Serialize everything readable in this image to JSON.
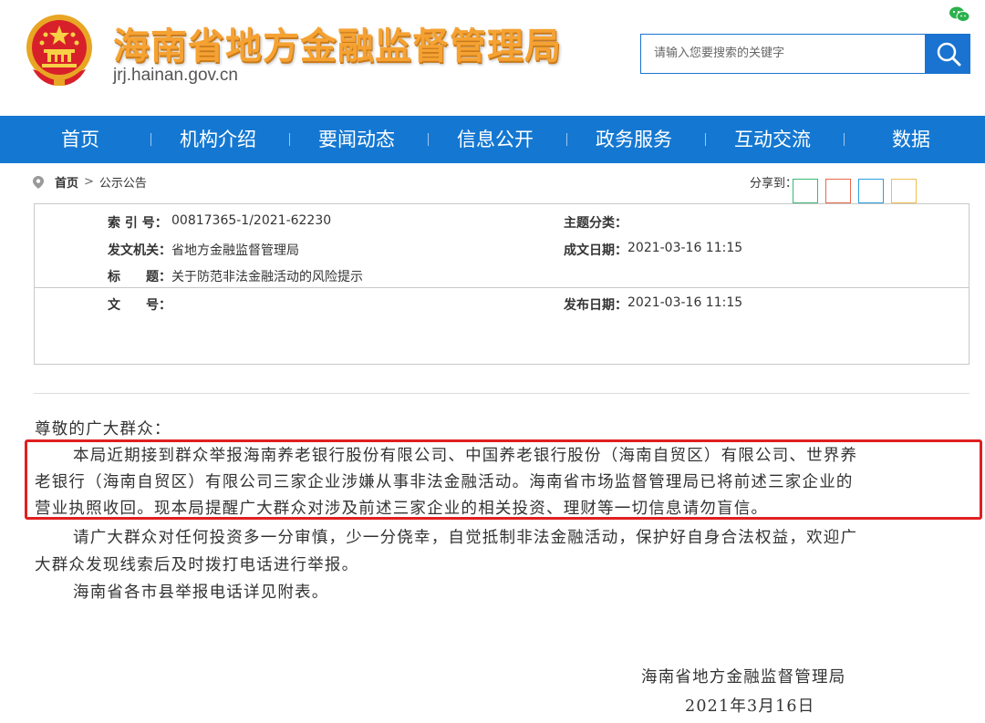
{
  "header": {
    "site_title": "海南省地方金融监督管理局",
    "domain": "jrj.hainan.gov.cn",
    "search_placeholder": "请输入您要搜索的关键字"
  },
  "nav": {
    "items": [
      "首页",
      "机构介绍",
      "要闻动态",
      "信息公开",
      "政务服务",
      "互动交流",
      "数据"
    ]
  },
  "breadcrumb": {
    "home": "首页",
    "separator": ">",
    "current": "公示公告"
  },
  "share": {
    "label": "分享到：",
    "colors": [
      "#3cb878",
      "#e8674e",
      "#2aa0e0",
      "#f0c050"
    ]
  },
  "info": {
    "index_label": "索 引 号：",
    "index_value": "00817365-1/2021-62230",
    "category_label": "主题分类：",
    "category_value": "",
    "issuer_label": "发文机关：",
    "issuer_value": "省地方金融监督管理局",
    "created_label": "成文日期：",
    "created_value": "2021-03-16 11:15",
    "title_label": "标　　题：",
    "title_value": "关于防范非法金融活动的风险提示",
    "docno_label": "文　　号：",
    "docno_value": "",
    "published_label": "发布日期：",
    "published_value": "2021-03-16 11:15"
  },
  "article": {
    "salutation": "尊敬的广大群众：",
    "p1_lines": [
      "本局近期接到群众举报海南养老银行股份有限公司、中国养老银行股份（海南自贸区）有限公司、世界养",
      "老银行（海南自贸区）有限公司三家企业涉嫌从事非法金融活动。海南省市场监督管理局已将前述三家企业的",
      "营业执照收回。现本局提醒广大群众对涉及前述三家企业的相关投资、理财等一切信息请勿盲信。"
    ],
    "p2_lines": [
      "请广大群众对任何投资多一分审慎，少一分侥幸，自觉抵制非法金融活动，保护好自身合法权益，欢迎广",
      "大群众发现线索后及时拨打电话进行举报。"
    ],
    "p3": "海南省各市县举报电话详见附表。",
    "signature": "海南省地方金融监督管理局",
    "date": "2021年3月16日"
  },
  "colors": {
    "nav_bg": "#1478d2",
    "title_orange": "#f5a233",
    "highlight_red": "#e02020"
  }
}
